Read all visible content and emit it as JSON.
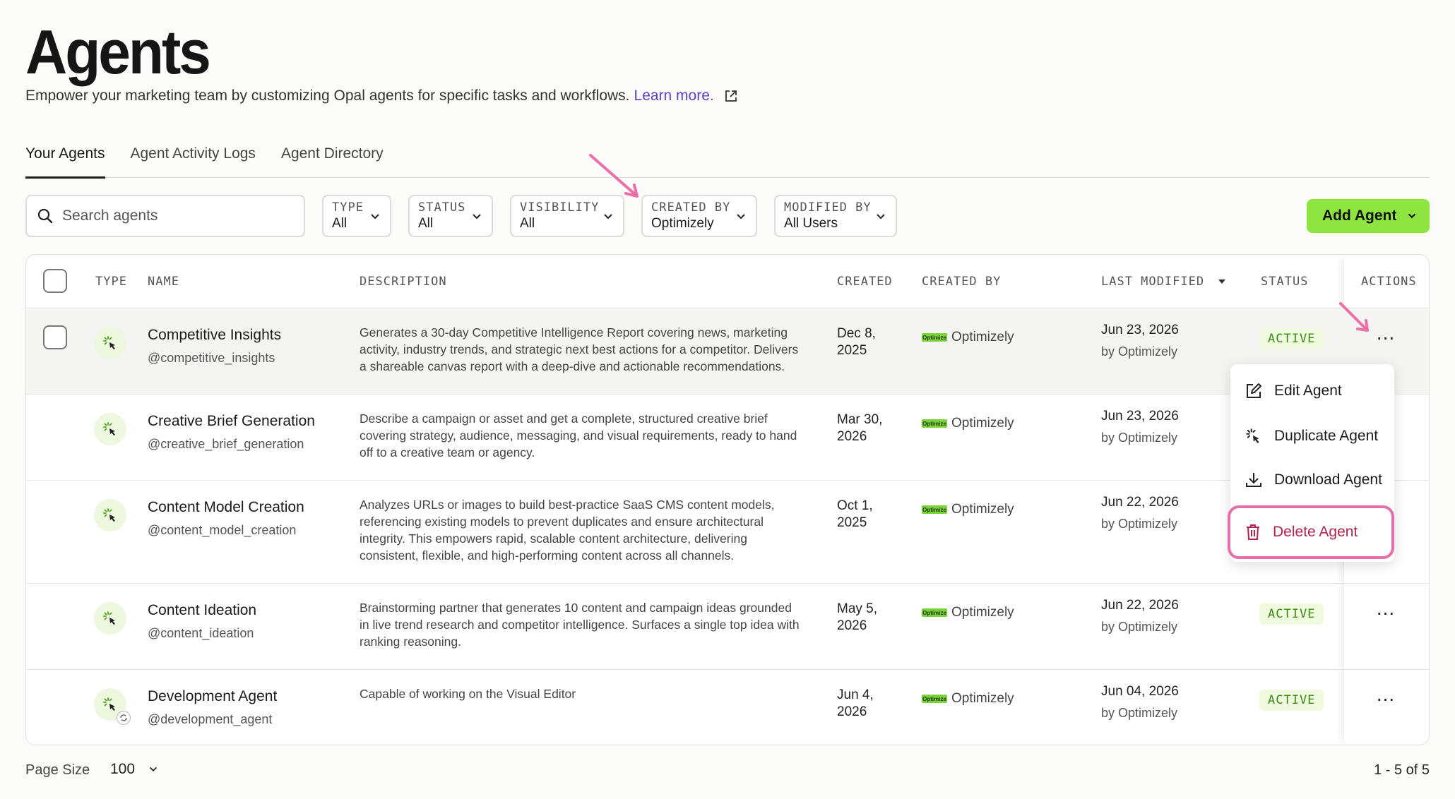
{
  "page": {
    "title": "Agents",
    "subtitle": "Empower your marketing team by customizing Opal agents for specific tasks and workflows.",
    "learn_more": "Learn more."
  },
  "tabs": [
    {
      "label": "Your Agents",
      "active": true
    },
    {
      "label": "Agent Activity Logs",
      "active": false
    },
    {
      "label": "Agent Directory",
      "active": false
    }
  ],
  "search": {
    "placeholder": "Search agents",
    "value": ""
  },
  "filters": [
    {
      "label": "TYPE",
      "value": "All"
    },
    {
      "label": "STATUS",
      "value": "All"
    },
    {
      "label": "VISIBILITY",
      "value": "All"
    },
    {
      "label": "CREATED BY",
      "value": "Optimizely"
    },
    {
      "label": "MODIFIED BY",
      "value": "All Users"
    }
  ],
  "add_agent_label": "Add Agent",
  "columns": {
    "type": "TYPE",
    "name": "NAME",
    "description": "DESCRIPTION",
    "created": "CREATED",
    "created_by": "CREATED BY",
    "last_modified": "LAST MODIFIED",
    "status": "STATUS",
    "actions": "ACTIONS"
  },
  "rows": [
    {
      "name": "Competitive Insights",
      "handle": "@competitive_insights",
      "description": "Generates a 30-day Competitive Intelligence Report covering news, marketing activity, industry trends, and strategic next best actions for a competitor. Delivers a shareable canvas report with a deep-dive and actionable recommendations.",
      "created_line1": "Dec 8,",
      "created_line2": "2025",
      "creator": "Optimizely",
      "modified": "Jun 23, 2026",
      "modified_by": "by Optimizely",
      "status": "ACTIVE",
      "actions": "..."
    },
    {
      "name": "Creative Brief Generation",
      "handle": "@creative_brief_generation",
      "description": "Describe a campaign or asset and get a complete, structured creative brief covering strategy, audience, messaging, and visual requirements, ready to hand off to a creative team or agency.",
      "created_line1": "Mar 30,",
      "created_line2": "2026",
      "creator": "Optimizely",
      "modified": "Jun 23, 2026",
      "modified_by": "by Optimizely",
      "status": "",
      "actions": ""
    },
    {
      "name": "Content Model Creation",
      "handle": "@content_model_creation",
      "description": "Analyzes URLs or images to build best-practice SaaS CMS content models, referencing existing models to prevent duplicates and ensure architectural integrity. This empowers rapid, scalable content architecture, delivering consistent, flexible, and high-performing content across all channels.",
      "created_line1": "Oct 1,",
      "created_line2": "2025",
      "creator": "Optimizely",
      "modified": "Jun 22, 2026",
      "modified_by": "by Optimizely",
      "status": "",
      "actions": ""
    },
    {
      "name": "Content Ideation",
      "handle": "@content_ideation",
      "description": "Brainstorming partner that generates 10 content and campaign ideas grounded in live trend research and competitor intelligence. Surfaces a single top idea with ranking reasoning.",
      "created_line1": "May 5,",
      "created_line2": "2026",
      "creator": "Optimizely",
      "modified": "Jun 22, 2026",
      "modified_by": "by Optimizely",
      "status": "ACTIVE",
      "actions": "..."
    },
    {
      "name": "Development Agent",
      "handle": "@development_agent",
      "description": "Capable of working on the Visual Editor",
      "created_line1": "Jun 4,",
      "created_line2": "2026",
      "creator": "Optimizely",
      "modified": "Jun 04, 2026",
      "modified_by": "by Optimizely",
      "status": "ACTIVE",
      "actions": "..."
    }
  ],
  "creator_logo_text": "Optimize",
  "menu": {
    "edit": "Edit Agent",
    "duplicate": "Duplicate Agent",
    "download": "Download Agent",
    "delete": "Delete Agent"
  },
  "footer": {
    "page_size_label": "Page Size",
    "page_size_value": "100",
    "pagination": "1 - 5 of 5"
  },
  "colors": {
    "accent_green": "#8ee53f",
    "link_purple": "#5b3fc4",
    "status_green": "#3a8a16",
    "delete_highlight": "#e56fa8",
    "annotation_arrow": "#ec6fa6"
  }
}
